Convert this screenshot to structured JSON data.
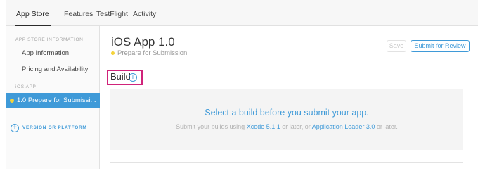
{
  "tabs": [
    {
      "label": "App Store",
      "active": true
    },
    {
      "label": "Features",
      "active": false
    },
    {
      "label": "TestFlight",
      "active": false
    },
    {
      "label": "Activity",
      "active": false
    }
  ],
  "sidebar": {
    "section_store_heading": "APP STORE INFORMATION",
    "store_items": [
      "App Information",
      "Pricing and Availability"
    ],
    "section_ios_heading": "iOS APP",
    "selected_version": "1.0 Prepare for Submissi...",
    "add_platform_label": "VERSION OR PLATFORM",
    "add_icon": "plus-circle-icon"
  },
  "app": {
    "title": "iOS App 1.0",
    "status": "Prepare for Submission",
    "status_color": "#f5d33b"
  },
  "toolbar": {
    "save_label": "Save",
    "submit_label": "Submit for Review"
  },
  "build": {
    "label": "Build",
    "add_icon": "plus-circle-icon",
    "heading": "Select a build before you submit your app.",
    "sub_prefix": "Submit your builds using ",
    "xcode_link": "Xcode 5.1.1",
    "sub_middle": " or later, or ",
    "loader_link": "Application Loader 3.0",
    "sub_suffix": " or later."
  },
  "colors": {
    "accent": "#3f9ad8",
    "highlight_box": "#d0237a"
  }
}
